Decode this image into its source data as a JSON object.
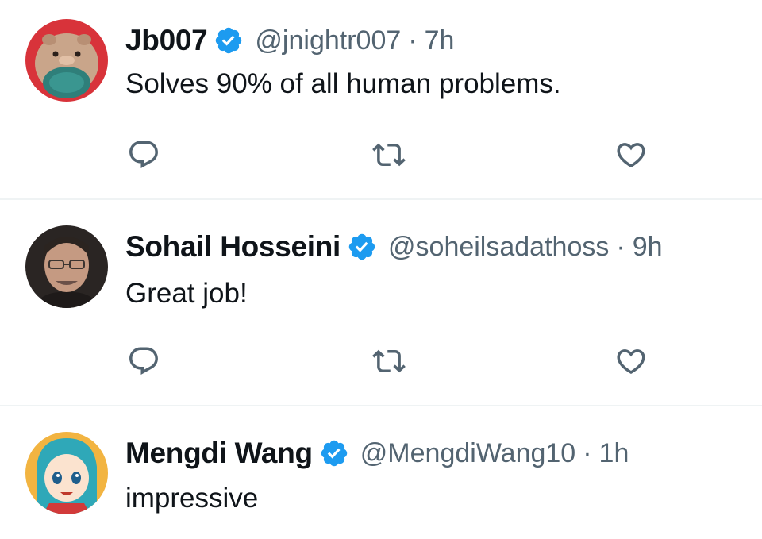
{
  "tweets": [
    {
      "display_name": "Jb007",
      "handle": "@jnightr007",
      "separator": "·",
      "time": "7h",
      "text": "Solves 90% of all human problems.",
      "verified": true,
      "avatar": "plush-toy-avatar"
    },
    {
      "display_name": "Sohail Hosseini",
      "handle": "@soheilsadathoss",
      "separator": "·",
      "time": "9h",
      "text": "Great job!",
      "verified": true,
      "avatar": "man-with-glasses-avatar"
    },
    {
      "display_name": "Mengdi Wang",
      "handle": "@MengdiWang10",
      "separator": "·",
      "time": "1h",
      "text": "impressive",
      "verified": true,
      "avatar": "anime-girl-avatar"
    }
  ],
  "icons": {
    "reply": "reply-icon",
    "retweet": "retweet-icon",
    "like": "heart-icon",
    "verified": "verified-badge-icon"
  },
  "colors": {
    "verified_blue": "#1d9bf0",
    "secondary_text": "#536471",
    "primary_text": "#0f1419",
    "divider": "#eff3f4"
  }
}
